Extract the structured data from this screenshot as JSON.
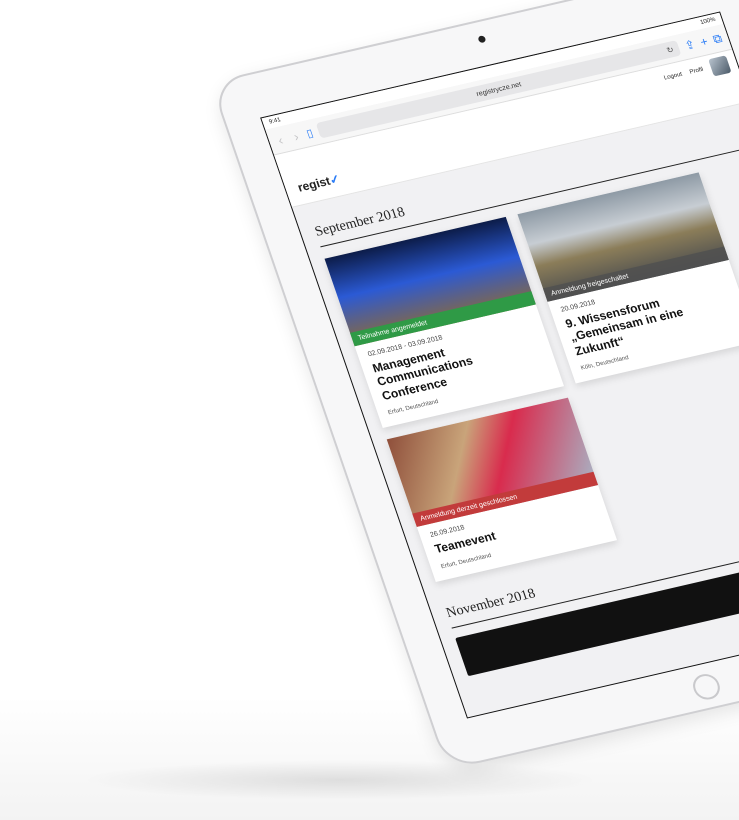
{
  "status_bar": {
    "time": "9:41",
    "battery": "100%"
  },
  "browser": {
    "url": "registrycze.net",
    "back_icon": "chevron-left-icon",
    "forward_icon": "chevron-right-icon",
    "bookmarks_icon": "book-icon",
    "share_icon": "share-icon",
    "new_tab_icon": "plus-icon",
    "tabs_icon": "tabs-icon"
  },
  "site": {
    "logo": "regist",
    "logo_mark": "✓",
    "logout_label": "Logout",
    "profile_label": "Profil"
  },
  "sections": [
    {
      "month": "September 2018",
      "events": [
        {
          "status": "Teilnahme angemeldet",
          "status_color": "#2f9a46",
          "date": "02.09.2018 - 03.09.2018",
          "title": "Management Communications Conference",
          "location": "Erfurt, Deutschland"
        },
        {
          "status": "Anmeldung freigeschaltet",
          "status_color": "#505050",
          "date": "20.09.2018",
          "title": "9. Wissensforum „Gemeinsam in eine Zukunft“",
          "location": "Köln, Deutschland"
        },
        {
          "status": "Anmeldung derzeit geschlossen",
          "status_color": "#c23b3b",
          "date": "26.09.2018",
          "title": "Teamevent",
          "location": "Erfurt, Deutschland"
        }
      ]
    },
    {
      "month": "November 2018"
    }
  ]
}
